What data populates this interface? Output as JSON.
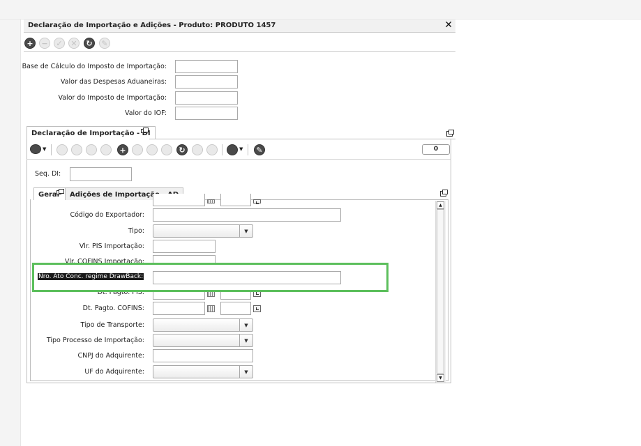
{
  "dialog": {
    "title": "Declaração de Importação e Adições - Produto: PRODUTO 1457",
    "close_label": "✕"
  },
  "toolbar_main": [
    {
      "name": "add-icon",
      "glyph": "+",
      "enabled": true
    },
    {
      "name": "remove-icon",
      "glyph": "−",
      "enabled": false
    },
    {
      "name": "confirm-icon",
      "glyph": "✓",
      "enabled": false
    },
    {
      "name": "cancel-icon",
      "glyph": "✕",
      "enabled": false
    },
    {
      "name": "refresh-icon",
      "glyph": "↻",
      "enabled": true
    },
    {
      "name": "edit-icon",
      "glyph": "✎",
      "enabled": false
    }
  ],
  "top_fields": [
    {
      "label": "Base de Cálculo do Imposto de Importação:",
      "value": ""
    },
    {
      "label": "Valor das Despesas Aduaneiras:",
      "value": ""
    },
    {
      "label": "Valor do Imposto de Importação:",
      "value": ""
    },
    {
      "label": "Valor do IOF:",
      "value": ""
    }
  ],
  "di_tab": {
    "label": "Declaração de Importação - DI"
  },
  "di_toolbar": {
    "counter": "0"
  },
  "seq_di": {
    "label": "Seq. DI:",
    "value": ""
  },
  "subtabs": {
    "geral": "Geral",
    "adicoes": "Adições de Importação - AD"
  },
  "form": {
    "codigo_exportador": {
      "label": "Código do Exportador:",
      "value": ""
    },
    "tipo": {
      "label": "Tipo:",
      "value": ""
    },
    "vlr_pis": {
      "label": "Vlr. PIS Importação:",
      "value": ""
    },
    "vlr_cofins": {
      "label": "Vlr. COFINS Importação:",
      "value": ""
    },
    "nro_ato": {
      "label": "Nro. Ato Conc. regime DrawBack:",
      "value": ""
    },
    "dt_pagto_pis": {
      "label": "Dt. Pagto. PIS:",
      "date": "",
      "time": ""
    },
    "dt_pagto_cofins": {
      "label": "Dt. Pagto. COFINS:",
      "date": "",
      "time": ""
    },
    "tipo_transporte": {
      "label": "Tipo de Transporte:",
      "value": ""
    },
    "tipo_processo": {
      "label": "Tipo Processo de Importação:",
      "value": ""
    },
    "cnpj_adquirente": {
      "label": "CNPJ do Adquirente:",
      "value": ""
    },
    "uf_adquirente": {
      "label": "UF do Adquirente:",
      "value": ""
    }
  },
  "colors": {
    "highlight": "#5cbf5c",
    "dark_button": "#4a4a4a"
  }
}
